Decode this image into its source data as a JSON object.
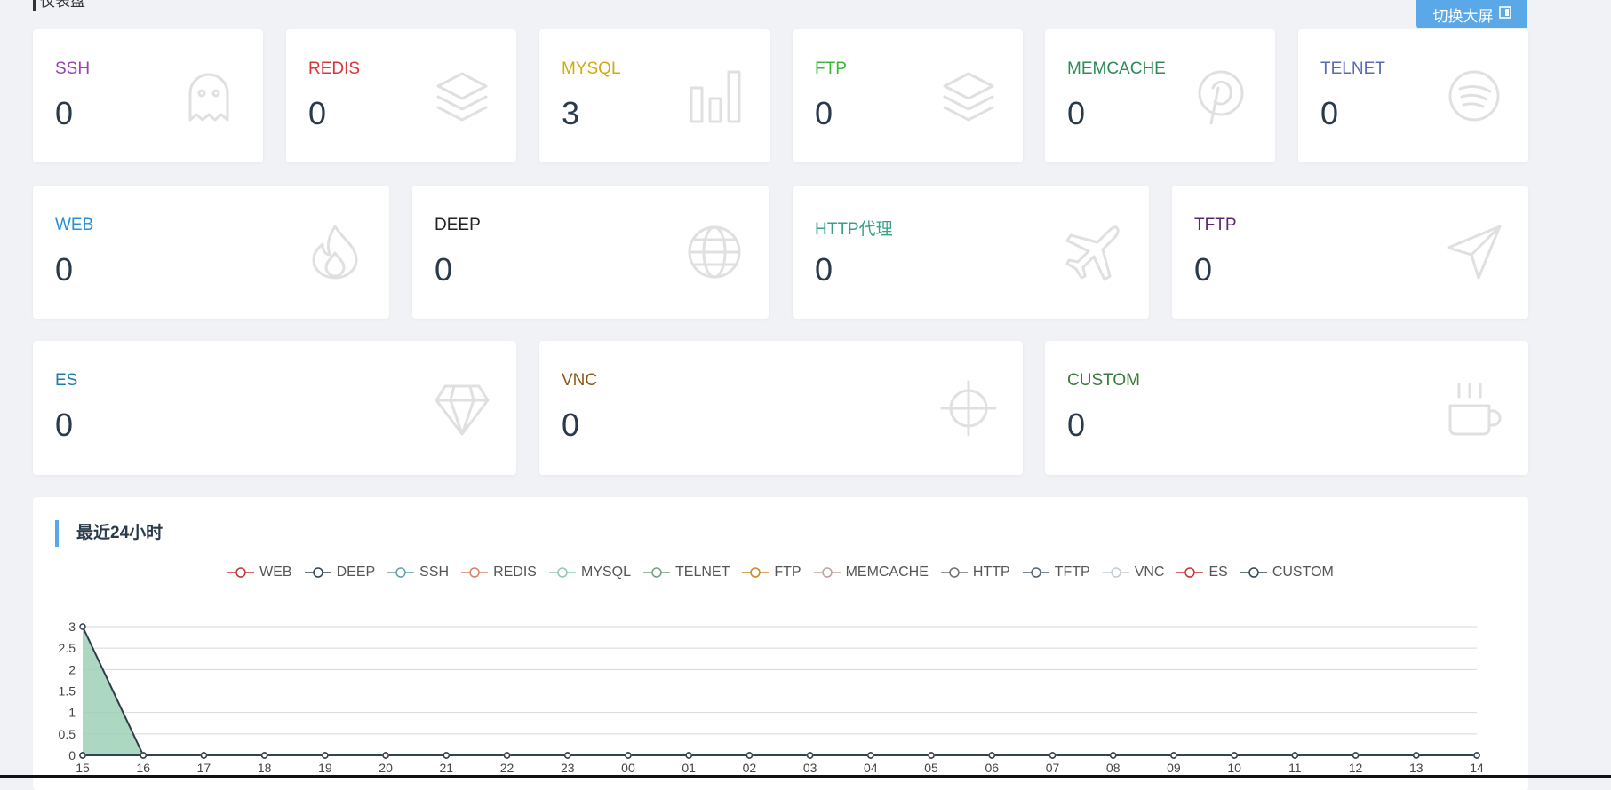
{
  "page": {
    "title": "仪表盘",
    "switch_button": "切换大屏"
  },
  "row1": [
    {
      "key": "ssh",
      "label": "SSH",
      "value": "0",
      "color": "#9c3fb3",
      "icon": "ghost-icon"
    },
    {
      "key": "redis",
      "label": "REDIS",
      "value": "0",
      "color": "#d9343a",
      "icon": "layers-icon"
    },
    {
      "key": "mysql",
      "label": "MYSQL",
      "value": "3",
      "color": "#d4a90c",
      "icon": "bar-chart-icon"
    },
    {
      "key": "ftp",
      "label": "FTP",
      "value": "0",
      "color": "#3bb83b",
      "icon": "layers-icon"
    },
    {
      "key": "memcache",
      "label": "MEMCACHE",
      "value": "0",
      "color": "#2e8b57",
      "icon": "pinterest-icon"
    },
    {
      "key": "telnet",
      "label": "TELNET",
      "value": "0",
      "color": "#5a6ab0",
      "icon": "spotify-icon"
    }
  ],
  "row2": [
    {
      "key": "web",
      "label": "WEB",
      "value": "0",
      "color": "#2a8fd8",
      "icon": "fire-icon"
    },
    {
      "key": "deep",
      "label": "DEEP",
      "value": "0",
      "color": "#222222",
      "icon": "globe-icon"
    },
    {
      "key": "http",
      "label": "HTTP代理",
      "value": "0",
      "color": "#3aa08a",
      "icon": "airplane-icon"
    },
    {
      "key": "tftp",
      "label": "TFTP",
      "value": "0",
      "color": "#5b2a6e",
      "icon": "send-icon"
    }
  ],
  "row3": [
    {
      "key": "es",
      "label": "ES",
      "value": "0",
      "color": "#1c7ea8",
      "icon": "diamond-icon"
    },
    {
      "key": "vnc",
      "label": "VNC",
      "value": "0",
      "color": "#8b5a1a",
      "icon": "crosshair-icon"
    },
    {
      "key": "custom",
      "label": "CUSTOM",
      "value": "0",
      "color": "#3a7a3a",
      "icon": "coffee-icon"
    }
  ],
  "chart_panel": {
    "title": "最近24小时"
  },
  "chart_data": {
    "type": "line",
    "categories": [
      "15",
      "16",
      "17",
      "18",
      "19",
      "20",
      "21",
      "22",
      "23",
      "00",
      "01",
      "02",
      "03",
      "04",
      "05",
      "06",
      "07",
      "08",
      "09",
      "10",
      "11",
      "12",
      "13",
      "14"
    ],
    "ylim": [
      0,
      3
    ],
    "yticks": [
      "0",
      "0.5",
      "1",
      "1.5",
      "2",
      "2.5",
      "3"
    ],
    "grid": true,
    "legend_position": "top-center",
    "series": [
      {
        "name": "WEB",
        "color": "#c23531",
        "values": [
          0,
          0,
          0,
          0,
          0,
          0,
          0,
          0,
          0,
          0,
          0,
          0,
          0,
          0,
          0,
          0,
          0,
          0,
          0,
          0,
          0,
          0,
          0,
          0
        ]
      },
      {
        "name": "DEEP",
        "color": "#2f4554",
        "values": [
          0,
          0,
          0,
          0,
          0,
          0,
          0,
          0,
          0,
          0,
          0,
          0,
          0,
          0,
          0,
          0,
          0,
          0,
          0,
          0,
          0,
          0,
          0,
          0
        ]
      },
      {
        "name": "SSH",
        "color": "#61a0a8",
        "values": [
          0,
          0,
          0,
          0,
          0,
          0,
          0,
          0,
          0,
          0,
          0,
          0,
          0,
          0,
          0,
          0,
          0,
          0,
          0,
          0,
          0,
          0,
          0,
          0
        ]
      },
      {
        "name": "REDIS",
        "color": "#d48265",
        "values": [
          0,
          0,
          0,
          0,
          0,
          0,
          0,
          0,
          0,
          0,
          0,
          0,
          0,
          0,
          0,
          0,
          0,
          0,
          0,
          0,
          0,
          0,
          0,
          0
        ]
      },
      {
        "name": "MYSQL",
        "color": "#91c7ae",
        "values": [
          3,
          0,
          0,
          0,
          0,
          0,
          0,
          0,
          0,
          0,
          0,
          0,
          0,
          0,
          0,
          0,
          0,
          0,
          0,
          0,
          0,
          0,
          0,
          0
        ]
      },
      {
        "name": "TELNET",
        "color": "#749f83",
        "values": [
          0,
          0,
          0,
          0,
          0,
          0,
          0,
          0,
          0,
          0,
          0,
          0,
          0,
          0,
          0,
          0,
          0,
          0,
          0,
          0,
          0,
          0,
          0,
          0
        ]
      },
      {
        "name": "FTP",
        "color": "#ca8622",
        "values": [
          0,
          0,
          0,
          0,
          0,
          0,
          0,
          0,
          0,
          0,
          0,
          0,
          0,
          0,
          0,
          0,
          0,
          0,
          0,
          0,
          0,
          0,
          0,
          0
        ]
      },
      {
        "name": "MEMCACHE",
        "color": "#bda29a",
        "values": [
          0,
          0,
          0,
          0,
          0,
          0,
          0,
          0,
          0,
          0,
          0,
          0,
          0,
          0,
          0,
          0,
          0,
          0,
          0,
          0,
          0,
          0,
          0,
          0
        ]
      },
      {
        "name": "HTTP",
        "color": "#6e7074",
        "values": [
          0,
          0,
          0,
          0,
          0,
          0,
          0,
          0,
          0,
          0,
          0,
          0,
          0,
          0,
          0,
          0,
          0,
          0,
          0,
          0,
          0,
          0,
          0,
          0
        ]
      },
      {
        "name": "TFTP",
        "color": "#546570",
        "values": [
          0,
          0,
          0,
          0,
          0,
          0,
          0,
          0,
          0,
          0,
          0,
          0,
          0,
          0,
          0,
          0,
          0,
          0,
          0,
          0,
          0,
          0,
          0,
          0
        ]
      },
      {
        "name": "VNC",
        "color": "#c4ccd3",
        "values": [
          0,
          0,
          0,
          0,
          0,
          0,
          0,
          0,
          0,
          0,
          0,
          0,
          0,
          0,
          0,
          0,
          0,
          0,
          0,
          0,
          0,
          0,
          0,
          0
        ]
      },
      {
        "name": "ES",
        "color": "#c23531",
        "values": [
          0,
          0,
          0,
          0,
          0,
          0,
          0,
          0,
          0,
          0,
          0,
          0,
          0,
          0,
          0,
          0,
          0,
          0,
          0,
          0,
          0,
          0,
          0,
          0
        ]
      },
      {
        "name": "CUSTOM",
        "color": "#2f4554",
        "values": [
          0,
          0,
          0,
          0,
          0,
          0,
          0,
          0,
          0,
          0,
          0,
          0,
          0,
          0,
          0,
          0,
          0,
          0,
          0,
          0,
          0,
          0,
          0,
          0
        ]
      }
    ]
  }
}
